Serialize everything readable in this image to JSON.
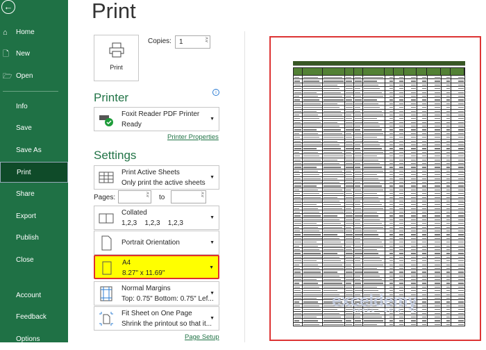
{
  "sidebar": {
    "back": "back-arrow",
    "items": [
      {
        "label": "Home"
      },
      {
        "label": "New"
      },
      {
        "label": "Open"
      },
      {
        "label": "Info"
      },
      {
        "label": "Save"
      },
      {
        "label": "Save As"
      },
      {
        "label": "Print"
      },
      {
        "label": "Share"
      },
      {
        "label": "Export"
      },
      {
        "label": "Publish"
      },
      {
        "label": "Close"
      },
      {
        "label": "Account"
      },
      {
        "label": "Feedback"
      },
      {
        "label": "Options"
      }
    ],
    "selected": "Print",
    "color": "#1f7145"
  },
  "title": "Print",
  "print_button": "Print",
  "copies": {
    "label": "Copies:",
    "value": "1"
  },
  "printer": {
    "heading": "Printer",
    "name": "Foxit Reader PDF Printer",
    "status": "Ready",
    "properties_link": "Printer Properties"
  },
  "settings": {
    "heading": "Settings",
    "sheets": {
      "title": "Print Active Sheets",
      "sub": "Only print the active sheets"
    },
    "pages": {
      "label": "Pages:",
      "to": "to",
      "from_value": "",
      "to_value": ""
    },
    "collation": {
      "title": "Collated",
      "sub": "1,2,3    1,2,3    1,2,3"
    },
    "orientation": {
      "title": "Portrait Orientation"
    },
    "paper": {
      "title": "A4",
      "sub": "8.27\" x 11.69\"",
      "highlight": "#ffff00"
    },
    "margins": {
      "title": "Normal Margins",
      "sub": "Top: 0.75\" Bottom: 0.75\" Lef..."
    },
    "scaling": {
      "title": "Fit Sheet on One Page",
      "sub": "Shrink the printout so that it..."
    },
    "page_setup_link": "Page Setup"
  },
  "watermark": {
    "brand": "exceldemy",
    "tag": "EXCEL · DATA · BI"
  }
}
